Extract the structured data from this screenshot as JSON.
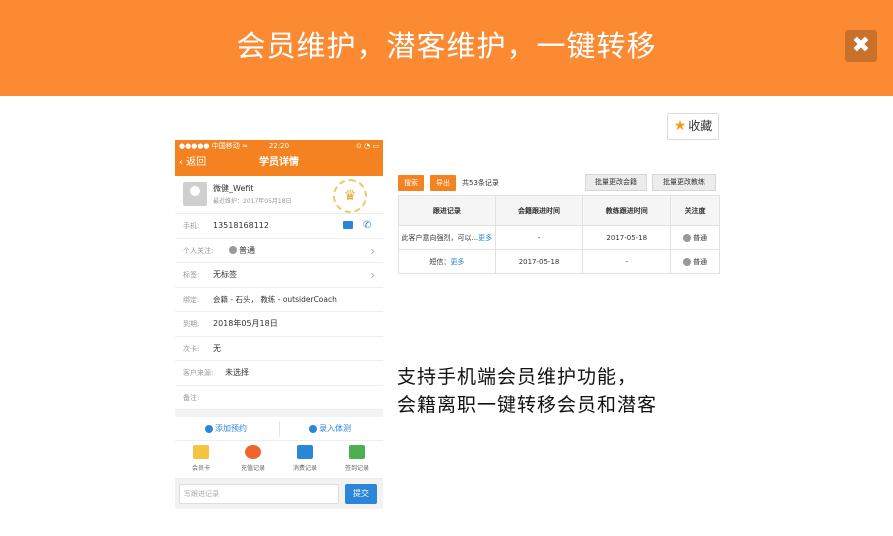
{
  "header": {
    "title": "会员维护，潜客维护，一键转移",
    "close_icon": "close-icon"
  },
  "favorite": {
    "label": "收藏",
    "icon": "star-icon"
  },
  "phone": {
    "status": {
      "carrier": "●●●●● 中国移动 ≈",
      "time": "22:20",
      "battery": "⊙ ◔ ▭"
    },
    "nav": {
      "back": "‹ 返回",
      "title": "学员详情"
    },
    "profile": {
      "name": "微健_Wefit",
      "subtitle": "最近维护：2017年05月18日"
    },
    "rows": [
      {
        "label": "手机:",
        "value": "13518168112"
      },
      {
        "label": "个人关注:",
        "value": "普通"
      },
      {
        "label": "标签:",
        "value": "无标签"
      },
      {
        "label": "绑定:",
        "value": "会籍 - 石头， 教练 - outsiderCoach"
      },
      {
        "label": "到期:",
        "value": "2018年05月18日"
      },
      {
        "label": "次卡:",
        "value": "无"
      },
      {
        "label": "客户来源:",
        "value": "未选择"
      },
      {
        "label": "备注:",
        "value": ""
      }
    ],
    "actions": {
      "add_booking": "添加预约",
      "record_test": "录入体测"
    },
    "tabs": [
      "会员卡",
      "充值记录",
      "消费记录",
      "签到记录"
    ],
    "input_placeholder": "写跟进记录",
    "submit": "提交",
    "colors": {
      "brand": "#f58220",
      "link": "#2b86d9"
    }
  },
  "panel": {
    "search": "搜索",
    "export": "导出",
    "count": "共53条记录",
    "batch_sales": "批量更改会籍",
    "batch_coach": "批量更改教练",
    "headers": [
      "跟进记录",
      "会籍跟进时间",
      "教练跟进时间",
      "关注度"
    ],
    "rows": [
      {
        "note": "此客户意向强烈，可以...",
        "more": "更多",
        "sales_time": "-",
        "coach_time": "2017-05-18",
        "level": "普通"
      },
      {
        "note": "短信：",
        "more": "更多",
        "sales_time": "2017-05-18",
        "coach_time": "-",
        "level": "普通"
      }
    ]
  },
  "description": {
    "line1": "支持手机端会员维护功能，",
    "line2": "会籍离职一键转移会员和潜客"
  }
}
